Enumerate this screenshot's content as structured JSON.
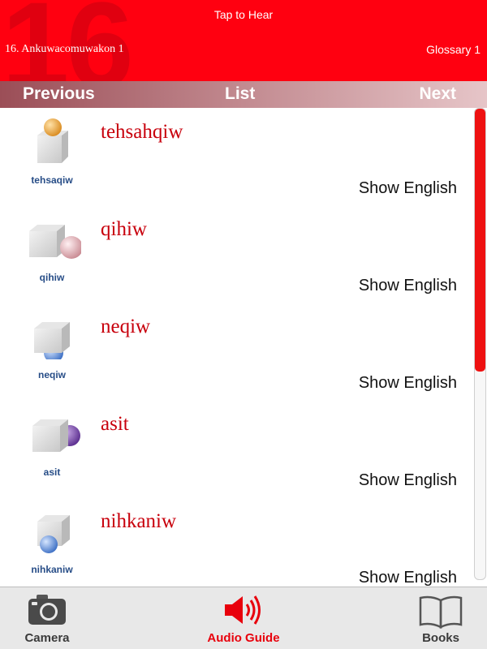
{
  "header": {
    "lesson_number": "16",
    "tap_to_hear": "Tap to Hear",
    "lesson_title": "16. Ankuwacomuwakon 1",
    "glossary": "Glossary 1",
    "color": "#ff0010"
  },
  "navbar": {
    "previous": "Previous",
    "list": "List",
    "next": "Next"
  },
  "entries": [
    {
      "word": "tehsahqiw",
      "thumb_label": "tehsaqiw",
      "show_english": "Show English",
      "picture": "ball-on-cube-icon"
    },
    {
      "word": "qihiw",
      "thumb_label": "qihiw",
      "show_english": "Show English",
      "picture": "ball-beside-cube-icon"
    },
    {
      "word": "neqiw",
      "thumb_label": "neqiw",
      "show_english": "Show English",
      "picture": "ball-under-cube-icon"
    },
    {
      "word": "asit",
      "thumb_label": "asit",
      "show_english": "Show English",
      "picture": "ball-behind-cube-icon"
    },
    {
      "word": "nihkaniw",
      "thumb_label": "nihkaniw",
      "show_english": "Show English",
      "picture": "ball-in-front-of-cube-icon"
    }
  ],
  "tabbar": {
    "camera": "Camera",
    "audio_guide": "Audio Guide",
    "books": "Books",
    "active_color": "#e8000c"
  }
}
